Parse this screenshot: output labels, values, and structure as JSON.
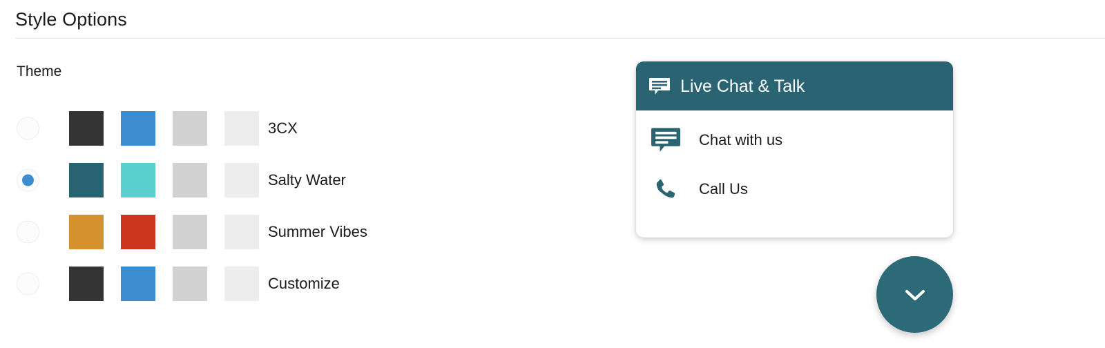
{
  "header": {
    "title": "Style Options"
  },
  "theme_section": {
    "label": "Theme",
    "themes": [
      {
        "name": "3CX",
        "selected": false,
        "swatches": [
          "#343434",
          "#3b8dd0",
          "#d2d2d2",
          "#ededed"
        ]
      },
      {
        "name": "Salty Water",
        "selected": true,
        "swatches": [
          "#2a6472",
          "#58d0d0",
          "#d2d2d2",
          "#ededed"
        ]
      },
      {
        "name": "Summer Vibes",
        "selected": false,
        "swatches": [
          "#d4912e",
          "#cc3520",
          "#d2d2d2",
          "#ededed"
        ]
      },
      {
        "name": "Customize",
        "selected": false,
        "swatches": [
          "#343434",
          "#3b8dd0",
          "#d2d2d2",
          "#ededed"
        ]
      }
    ],
    "radio_selected_color": "#3b8dd0"
  },
  "chat_widget": {
    "header": {
      "title": "Live Chat & Talk",
      "icon": "chat-bubble-icon",
      "background_color": "#2a6472",
      "text_color": "#ffffff"
    },
    "items": [
      {
        "label": "Chat with us",
        "icon": "chat-bubble-icon"
      },
      {
        "label": "Call Us",
        "icon": "phone-icon"
      }
    ],
    "toggle_button": {
      "icon": "chevron-down-icon",
      "background_color": "#2d6a78",
      "icon_color": "#ffffff"
    }
  }
}
